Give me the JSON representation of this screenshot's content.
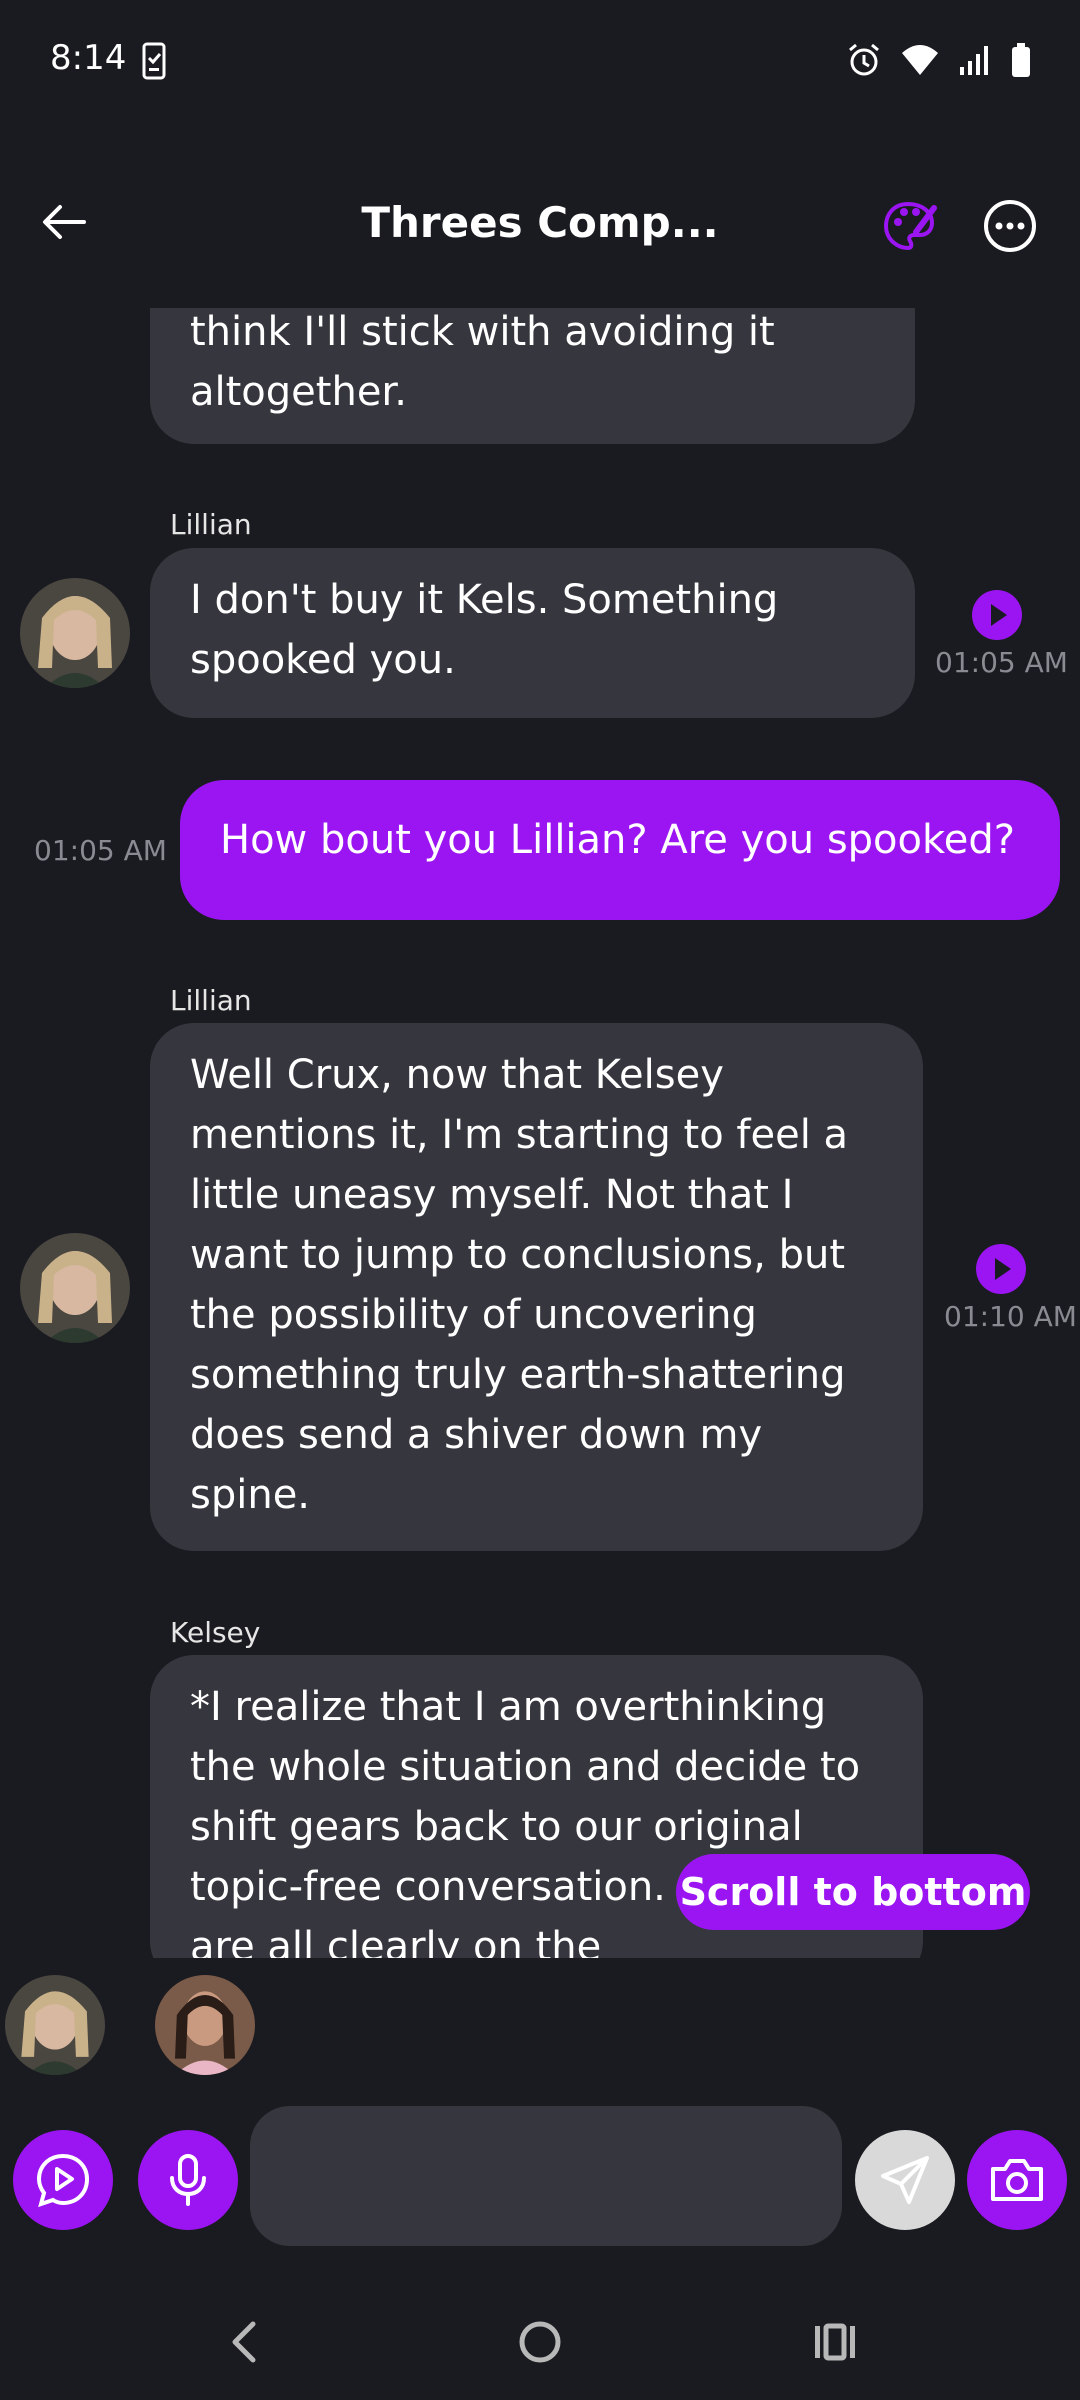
{
  "status_bar": {
    "time": "8:14",
    "icons": [
      "clipboard-check-icon",
      "alarm-icon",
      "wifi-icon",
      "signal-icon",
      "battery-icon"
    ]
  },
  "header": {
    "title": "Threes Comp...",
    "icons": [
      "back-arrow-icon",
      "palette-icon",
      "more-horizontal-icon"
    ]
  },
  "messages": [
    {
      "sender": "",
      "text": "think I'll stick with avoiding it altogether.",
      "time": "",
      "mine": false
    },
    {
      "sender": "Lillian",
      "text": "I don't buy it Kels. Something spooked you.",
      "time": "01:05 AM",
      "mine": false
    },
    {
      "sender": "",
      "text": "How bout you Lillian? Are you spooked?",
      "time": "01:05 AM",
      "mine": true
    },
    {
      "sender": "Lillian",
      "text": "Well Crux, now that Kelsey mentions it, I'm starting to feel a little uneasy myself. Not that I want to jump to conclusions, but the possibility of uncovering something truly earth-shattering does send a shiver down my spine.",
      "time": "01:10 AM",
      "mine": false
    },
    {
      "sender": "Kelsey",
      "text": "*I realize that I am overthinking the whole situation and decide to shift gears back to our original topic-free conversation. Since we are all clearly on the",
      "time": "",
      "mine": false
    }
  ],
  "scroll_button": {
    "label": "Scroll to bottom"
  },
  "participants": [
    "Lillian",
    "Kelsey"
  ],
  "composer": {
    "placeholder": "",
    "buttons": [
      "play-chat-icon",
      "microphone-icon",
      "send-icon",
      "camera-icon"
    ]
  },
  "nav_bar": {
    "buttons": [
      "back-nav-icon",
      "home-nav-icon",
      "recents-nav-icon"
    ]
  },
  "colors": {
    "accent": "#9b15f2",
    "background": "#1a1b20",
    "bubble": "#36373e",
    "send_button": "#d9d9d9"
  }
}
